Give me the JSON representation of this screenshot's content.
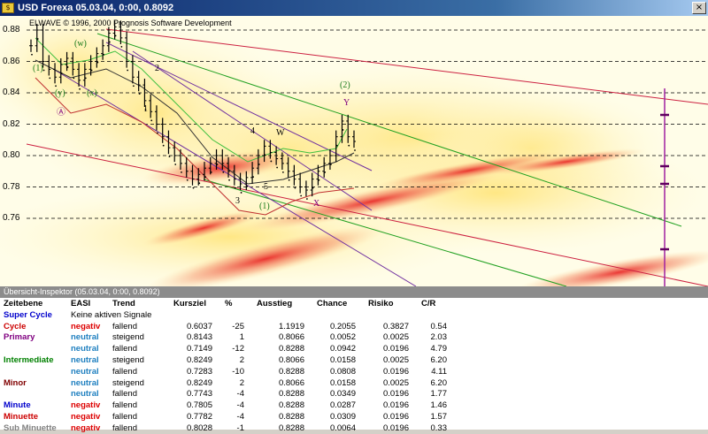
{
  "window": {
    "title": "USD Forexa  05.03.04, 0:00, 0.8092",
    "close_label": "×"
  },
  "chart": {
    "copyright": "ELWAVE © 1996, 2000 Prognosis Software Development",
    "y_ticks": [
      "0.88",
      "0.86",
      "0.84",
      "0.82",
      "0.80",
      "0.78",
      "0.76"
    ],
    "wave_labels": {
      "w": "(w)",
      "y_open": "(y)",
      "x_paren": "(x)",
      "a_circ": "Ⓐ",
      "one_paren": "(1)",
      "two": "2",
      "one": "1",
      "four": "4",
      "three": "3",
      "five": "5",
      "w_plain": "W",
      "one_circ": "(1)",
      "two_circ": "(2)",
      "y_plain": "Y",
      "x_plain": "X"
    }
  },
  "chart_data": {
    "type": "candlestick",
    "title": "",
    "ylim": [
      0.745,
      0.89
    ],
    "y_ticks": [
      0.88,
      0.86,
      0.84,
      0.82,
      0.8,
      0.78,
      0.76
    ],
    "close_series": [
      0.87,
      0.88,
      0.86,
      0.855,
      0.85,
      0.858,
      0.862,
      0.855,
      0.848,
      0.855,
      0.86,
      0.865,
      0.87,
      0.878,
      0.882,
      0.875,
      0.86,
      0.85,
      0.845,
      0.835,
      0.828,
      0.82,
      0.812,
      0.805,
      0.8,
      0.795,
      0.79,
      0.785,
      0.788,
      0.792,
      0.795,
      0.8,
      0.795,
      0.79,
      0.785,
      0.782,
      0.786,
      0.792,
      0.8,
      0.806,
      0.802,
      0.798,
      0.795,
      0.79,
      0.785,
      0.78,
      0.778,
      0.785,
      0.79,
      0.795,
      0.8,
      0.812,
      0.822,
      0.812,
      0.809
    ]
  },
  "inspector": {
    "title": "Übersicht-Inspektor (05.03.04, 0:00, 0.8092)",
    "headers": [
      "Zeitebene",
      "EASI",
      "Trend",
      "Kursziel",
      "%",
      "Ausstieg",
      "Chance",
      "Risiko",
      "C/R"
    ],
    "rows": [
      {
        "level": "Super Cycle",
        "level_color": "#0000cc",
        "easi": "Keine aktiven Signale",
        "easi_color": "#000000",
        "trend": "",
        "kursziel": "",
        "pct": "",
        "ausstieg": "",
        "chance": "",
        "risiko": "",
        "cr": ""
      },
      {
        "level": "Cycle",
        "level_color": "#cc0000",
        "easi": "negativ",
        "easi_color": "#dd0000",
        "trend": "fallend",
        "kursziel": "0.6037",
        "pct": "-25",
        "ausstieg": "1.1919",
        "chance": "0.2055",
        "risiko": "0.3827",
        "cr": "0.54"
      },
      {
        "level": "Primary",
        "level_color": "#800080",
        "easi": "neutral",
        "easi_color": "#2080c0",
        "trend": "steigend",
        "kursziel": "0.8143",
        "pct": "1",
        "ausstieg": "0.8066",
        "chance": "0.0052",
        "risiko": "0.0025",
        "cr": "2.03"
      },
      {
        "level": "",
        "level_color": "#000000",
        "easi": "neutral",
        "easi_color": "#2080c0",
        "trend": "fallend",
        "kursziel": "0.7149",
        "pct": "-12",
        "ausstieg": "0.8288",
        "chance": "0.0942",
        "risiko": "0.0196",
        "cr": "4.79"
      },
      {
        "level": "Intermediate",
        "level_color": "#008000",
        "easi": "neutral",
        "easi_color": "#2080c0",
        "trend": "steigend",
        "kursziel": "0.8249",
        "pct": "2",
        "ausstieg": "0.8066",
        "chance": "0.0158",
        "risiko": "0.0025",
        "cr": "6.20"
      },
      {
        "level": "",
        "level_color": "#000000",
        "easi": "neutral",
        "easi_color": "#2080c0",
        "trend": "fallend",
        "kursziel": "0.7283",
        "pct": "-10",
        "ausstieg": "0.8288",
        "chance": "0.0808",
        "risiko": "0.0196",
        "cr": "4.11"
      },
      {
        "level": "Minor",
        "level_color": "#800000",
        "easi": "neutral",
        "easi_color": "#2080c0",
        "trend": "steigend",
        "kursziel": "0.8249",
        "pct": "2",
        "ausstieg": "0.8066",
        "chance": "0.0158",
        "risiko": "0.0025",
        "cr": "6.20"
      },
      {
        "level": "",
        "level_color": "#000000",
        "easi": "neutral",
        "easi_color": "#2080c0",
        "trend": "fallend",
        "kursziel": "0.7743",
        "pct": "-4",
        "ausstieg": "0.8288",
        "chance": "0.0349",
        "risiko": "0.0196",
        "cr": "1.77"
      },
      {
        "level": "Minute",
        "level_color": "#0000cc",
        "easi": "negativ",
        "easi_color": "#dd0000",
        "trend": "fallend",
        "kursziel": "0.7805",
        "pct": "-4",
        "ausstieg": "0.8288",
        "chance": "0.0287",
        "risiko": "0.0196",
        "cr": "1.46"
      },
      {
        "level": "Minuette",
        "level_color": "#cc0000",
        "easi": "negativ",
        "easi_color": "#dd0000",
        "trend": "fallend",
        "kursziel": "0.7782",
        "pct": "-4",
        "ausstieg": "0.8288",
        "chance": "0.0309",
        "risiko": "0.0196",
        "cr": "1.57"
      },
      {
        "level": "Sub Minuette",
        "level_color": "#808080",
        "easi": "negativ",
        "easi_color": "#dd0000",
        "trend": "fallend",
        "kursziel": "0.8028",
        "pct": "-1",
        "ausstieg": "0.8288",
        "chance": "0.0064",
        "risiko": "0.0196",
        "cr": "0.33"
      }
    ]
  }
}
